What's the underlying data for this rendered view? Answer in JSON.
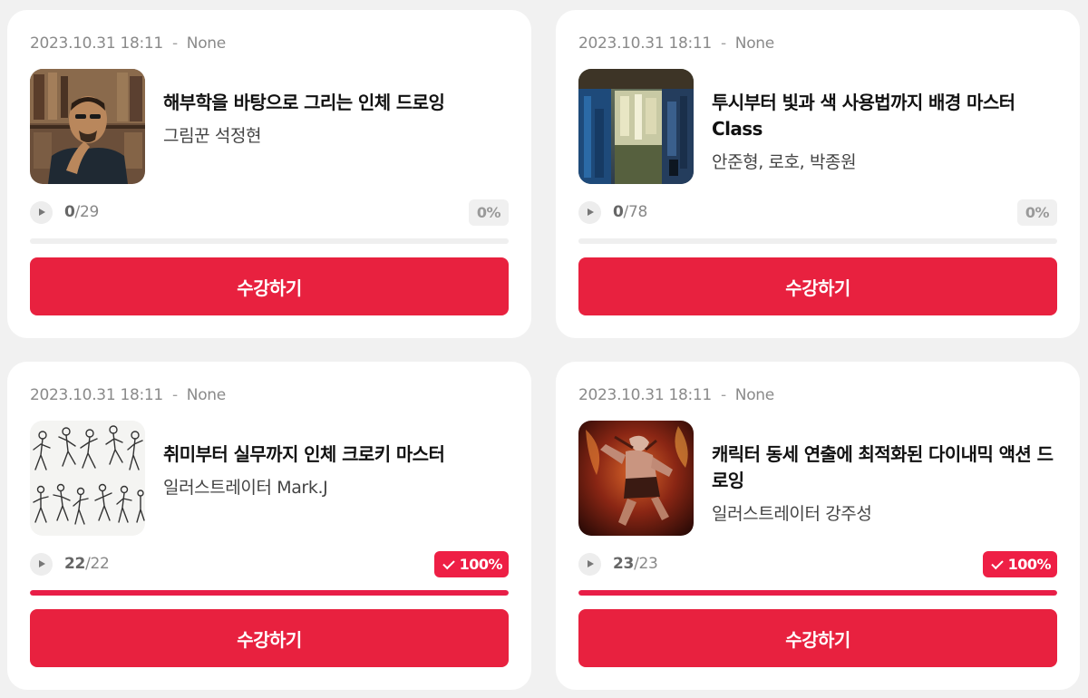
{
  "courses": [
    {
      "date": "2023.10.31 18:11",
      "separator": "-",
      "status": "None",
      "title": "해부학을 바탕으로 그리는 인체 드로잉",
      "instructor": "그림꾼 석정현",
      "progress_done": "0",
      "progress_total": "/29",
      "percent": "0%",
      "progress": 0,
      "button": "수강하기"
    },
    {
      "date": "2023.10.31 18:11",
      "separator": "-",
      "status": "None",
      "title": "투시부터 빛과 색 사용법까지 배경 마스터 Class",
      "instructor": "안준형, 로호, 박종원",
      "progress_done": "0",
      "progress_total": "/78",
      "percent": "0%",
      "progress": 0,
      "button": "수강하기"
    },
    {
      "date": "2023.10.31 18:11",
      "separator": "-",
      "status": "None",
      "title": "취미부터 실무까지 인체 크로키 마스터",
      "instructor": "일러스트레이터 Mark.J",
      "progress_done": "22",
      "progress_total": "/22",
      "percent": "100%",
      "progress": 1,
      "button": "수강하기"
    },
    {
      "date": "2023.10.31 18:11",
      "separator": "-",
      "status": "None",
      "title": "캐릭터 동세 연출에 최적화된 다이내믹 액션 드로잉",
      "instructor": "일러스트레이터 강주성",
      "progress_done": "23",
      "progress_total": "/23",
      "percent": "100%",
      "progress": 1,
      "button": "수강하기"
    }
  ],
  "colors": {
    "accent": "#e8213f",
    "progress_fill": "#e81e47",
    "badge_neutral_bg": "#f0f0f0"
  },
  "icons": {
    "play": "play-icon",
    "check": "check-icon"
  }
}
